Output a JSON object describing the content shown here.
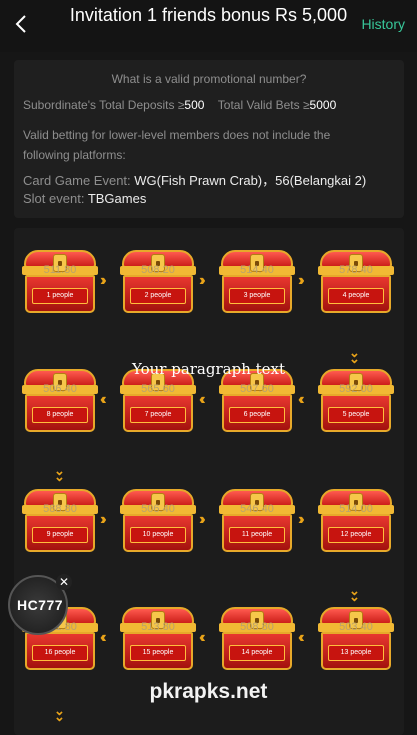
{
  "header": {
    "title": "Invitation 1 friends bonus Rs 5,000",
    "history_label": "History"
  },
  "info": {
    "question": "What is a valid promotional number?",
    "deposits_prefix": "Subordinate's Total Deposits ≥",
    "deposits_value": "500",
    "bets_prefix": "Total Valid Bets ≥",
    "bets_value": "5000",
    "note_line1": "Valid betting for lower-level members does not include the",
    "note_line2": "following platforms:",
    "card_label": "Card Game Event: ",
    "card_value": "WG(Fish Prawn Crab)，56(Belangkai 2)",
    "slot_label": "Slot event: ",
    "slot_value": "TBGames"
  },
  "chests": [
    {
      "amount": "511.80",
      "people": "1 people"
    },
    {
      "amount": "508.20",
      "people": "2 people"
    },
    {
      "amount": "514.40",
      "people": "3 people"
    },
    {
      "amount": "578.40",
      "people": "4 people"
    },
    {
      "amount": "506.40",
      "people": "8 people"
    },
    {
      "amount": "565.60",
      "people": "7 people"
    },
    {
      "amount": "507.60",
      "people": "6 people"
    },
    {
      "amount": "592.00",
      "people": "5 people"
    },
    {
      "amount": "588.80",
      "people": "9 people"
    },
    {
      "amount": "506.40",
      "people": "10 people"
    },
    {
      "amount": "546.40",
      "people": "11 people"
    },
    {
      "amount": "514.00",
      "people": "12 people"
    },
    {
      "amount": "501.80",
      "people": "16 people"
    },
    {
      "amount": "513.80",
      "people": "15 people"
    },
    {
      "amount": "508.80",
      "people": "14 people"
    },
    {
      "amount": "503.40",
      "people": "13 people"
    }
  ],
  "overlay_text": "Your paragraph text",
  "badge": {
    "label": "HC777",
    "close": "✕"
  },
  "watermark": "pkrapks.net",
  "icons": {
    "back": "chevron-left-icon",
    "arrow": "double-chevron-icon"
  },
  "colors": {
    "accent": "#38c79a",
    "chest_red": "#cc1f1a",
    "gold": "#e8a319"
  }
}
